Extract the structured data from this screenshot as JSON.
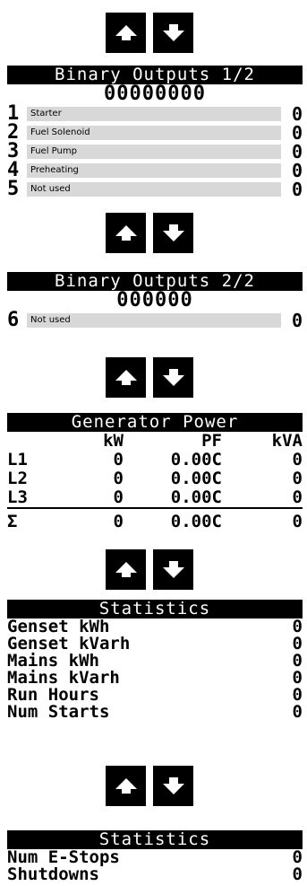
{
  "nav": {
    "up_icon": "arrow-up-icon",
    "down_icon": "arrow-down-icon"
  },
  "bo1": {
    "title": "Binary Outputs 1/2",
    "bits": "00000000",
    "rows": [
      {
        "num": "1",
        "label": "Starter",
        "value": "0"
      },
      {
        "num": "2",
        "label": "Fuel Solenoid",
        "value": "0"
      },
      {
        "num": "3",
        "label": "Fuel Pump",
        "value": "0"
      },
      {
        "num": "4",
        "label": "Preheating",
        "value": "0"
      },
      {
        "num": "5",
        "label": "Not used",
        "value": "0"
      }
    ]
  },
  "bo2": {
    "title": "Binary Outputs 2/2",
    "bits": "000000",
    "rows": [
      {
        "num": "6",
        "label": "Not used",
        "value": "0"
      }
    ]
  },
  "power": {
    "title": "Generator Power",
    "headers": [
      "",
      "kW",
      "PF",
      "kVA"
    ],
    "rows": [
      {
        "label": "L1",
        "kw": "0",
        "pf": "0.00C",
        "kva": "0"
      },
      {
        "label": "L2",
        "kw": "0",
        "pf": "0.00C",
        "kva": "0"
      },
      {
        "label": "L3",
        "kw": "0",
        "pf": "0.00C",
        "kva": "0"
      }
    ],
    "sum": {
      "label": "Σ",
      "kw": "0",
      "pf": "0.00C",
      "kva": "0"
    }
  },
  "stats1": {
    "title": "Statistics",
    "rows": [
      {
        "label": "Genset kWh",
        "value": "0"
      },
      {
        "label": "Genset kVarh",
        "value": "0"
      },
      {
        "label": "Mains kWh",
        "value": "0"
      },
      {
        "label": "Mains kVarh",
        "value": "0"
      },
      {
        "label": "Run Hours",
        "value": "0"
      },
      {
        "label": "Num Starts",
        "value": "0"
      }
    ]
  },
  "stats2": {
    "title": "Statistics",
    "rows": [
      {
        "label": "Num E-Stops",
        "value": "0"
      },
      {
        "label": "Shutdowns",
        "value": "0"
      }
    ]
  }
}
